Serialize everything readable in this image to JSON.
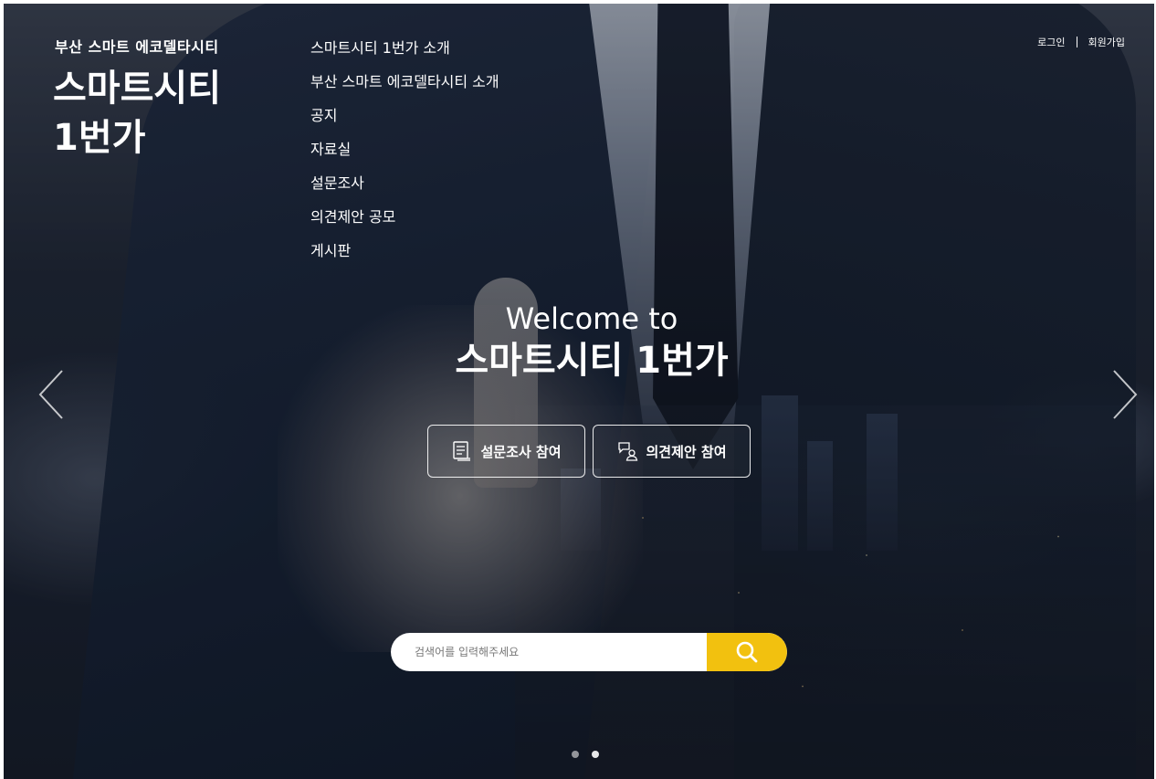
{
  "brand": {
    "subtitle": "부산 스마트 에코델타시티",
    "title": "스마트시티 1번가"
  },
  "nav": {
    "items": [
      {
        "label": "스마트시티 1번가 소개"
      },
      {
        "label": "부산 스마트 에코델타시티 소개"
      },
      {
        "label": "공지"
      },
      {
        "label": "자료실"
      },
      {
        "label": "설문조사"
      },
      {
        "label": "의견제안 공모"
      },
      {
        "label": "게시판"
      }
    ]
  },
  "util": {
    "login_label": "로그인",
    "signup_label": "회원가입"
  },
  "hero": {
    "welcome_line1": "Welcome to",
    "welcome_line2": "스마트시티 1번가",
    "survey_button_label": "설문조사 참여",
    "opinion_button_label": "의견제안 참여",
    "survey_icon": "survey-icon",
    "opinion_icon": "opinion-icon",
    "prev_icon": "chevron-left-icon",
    "next_icon": "chevron-right-icon"
  },
  "search": {
    "placeholder": "검색어를 입력해주세요",
    "value": "",
    "button_icon": "search-icon",
    "accent_color": "#f2c10f"
  },
  "slider": {
    "count": 2,
    "active_index": 1
  }
}
